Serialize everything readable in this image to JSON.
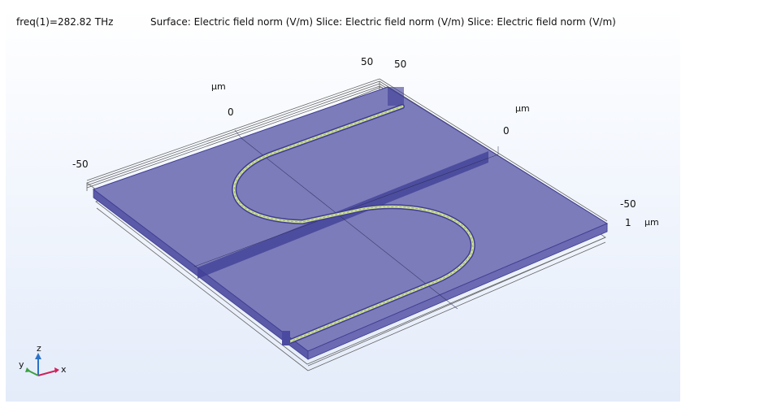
{
  "header": {
    "frequency": "freq(1)=282.82 THz",
    "plot_title": "Surface: Electric field norm (V/m)  Slice: Electric field norm (V/m)  Slice: Electric field norm (V/m)"
  },
  "axes": {
    "x_ticks": [
      "-50",
      "0",
      "50"
    ],
    "x_unit": "µm",
    "y_ticks": [
      "50",
      "0",
      "-50"
    ],
    "y_unit": "µm",
    "z_tick": "1",
    "z_unit": "µm"
  },
  "triad": {
    "x": "x",
    "y": "y",
    "z": "z"
  },
  "colors": {
    "slab": "#7a79b5",
    "slab_edge": "#4c4a9a",
    "waveguide": "#d2e29c",
    "background_top": "#ffffff",
    "background_bottom": "#e4ecfa"
  }
}
